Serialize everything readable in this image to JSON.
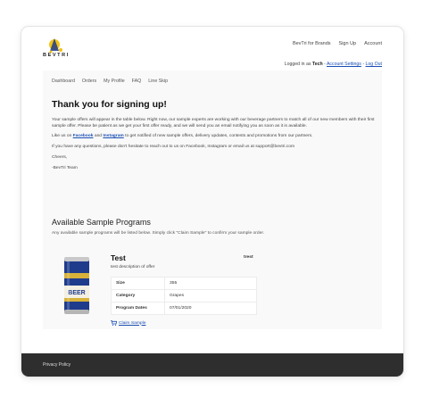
{
  "brand": {
    "name": "BEVTRI"
  },
  "top_nav": {
    "items": [
      "BevTri for Brands",
      "Sign Up",
      "Account"
    ]
  },
  "login": {
    "prefix": "Logged in as",
    "user": "Tech",
    "sep1": " - ",
    "settings": "Account Settings",
    "sep2": " - ",
    "logout": "Log Out"
  },
  "tabs": [
    "Dashboard",
    "Orders",
    "My Profile",
    "FAQ",
    "Line Skip"
  ],
  "signup": {
    "title": "Thank you for signing up!",
    "p1": "Your sample offers will appear in the table below. Right now, our sample experts are working with our beverage partners to match all of our new members with their first sample offer. Please be patient as we get your first offer ready, and we will send you an email notifying you as soon as it is available.",
    "p2_prefix": "Like us on ",
    "p2_facebook": "Facebook",
    "p2_and": " and ",
    "p2_instagram": "Instagram",
    "p2_suffix": " to get notified of new sample offers, delivery updates, contests and promotions from our partners.",
    "p3": "If you have any questions, please don't hesitate to reach out to us on Facebook, Instagram or email us at support@bevtri.com",
    "p4": "Cheers,",
    "p5": "-BevTri Team"
  },
  "programs": {
    "title": "Available Sample Programs",
    "desc": "Any available sample programs will be listed below. Simply click \"Claim Sample\" to confirm your sample order."
  },
  "product": {
    "title": "Test",
    "desc": "test description of offer",
    "brand": "trest",
    "can_label": "BEER",
    "specs": [
      {
        "key": "Size",
        "value": "355"
      },
      {
        "key": "Category",
        "value": "Grapes"
      },
      {
        "key": "Program Dates",
        "value": "07/01/2020"
      }
    ],
    "claim": "Claim Sample"
  },
  "footer": {
    "privacy": "Privacy Policy"
  },
  "colors": {
    "link": "#1a4fb5",
    "footer_bg": "#2e2e2e",
    "panel_bg": "#f9f9f9",
    "can_blue": "#1f3b8c",
    "can_gold": "#d8b13a"
  }
}
